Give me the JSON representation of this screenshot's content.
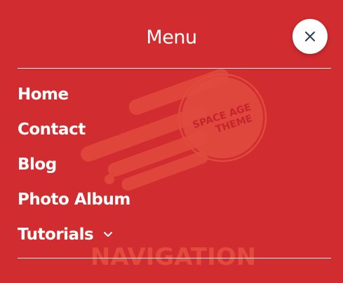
{
  "header": {
    "title": "Menu",
    "close_icon": "close-icon"
  },
  "nav": {
    "items": [
      {
        "label": "Home"
      },
      {
        "label": "Contact"
      },
      {
        "label": "Blog"
      },
      {
        "label": "Photo Album"
      },
      {
        "label": "Tutorials",
        "icon": "chevron-down-icon"
      }
    ]
  },
  "background_logo": {
    "badge_text_line1": "SPACE AGE",
    "badge_text_line2": "THEME",
    "wordmark": "NAVIGATION"
  },
  "colors": {
    "background": "#d12c2f",
    "text": "#ffffff",
    "logo_tint": "#e85a44",
    "close_icon": "#2b3a57"
  }
}
